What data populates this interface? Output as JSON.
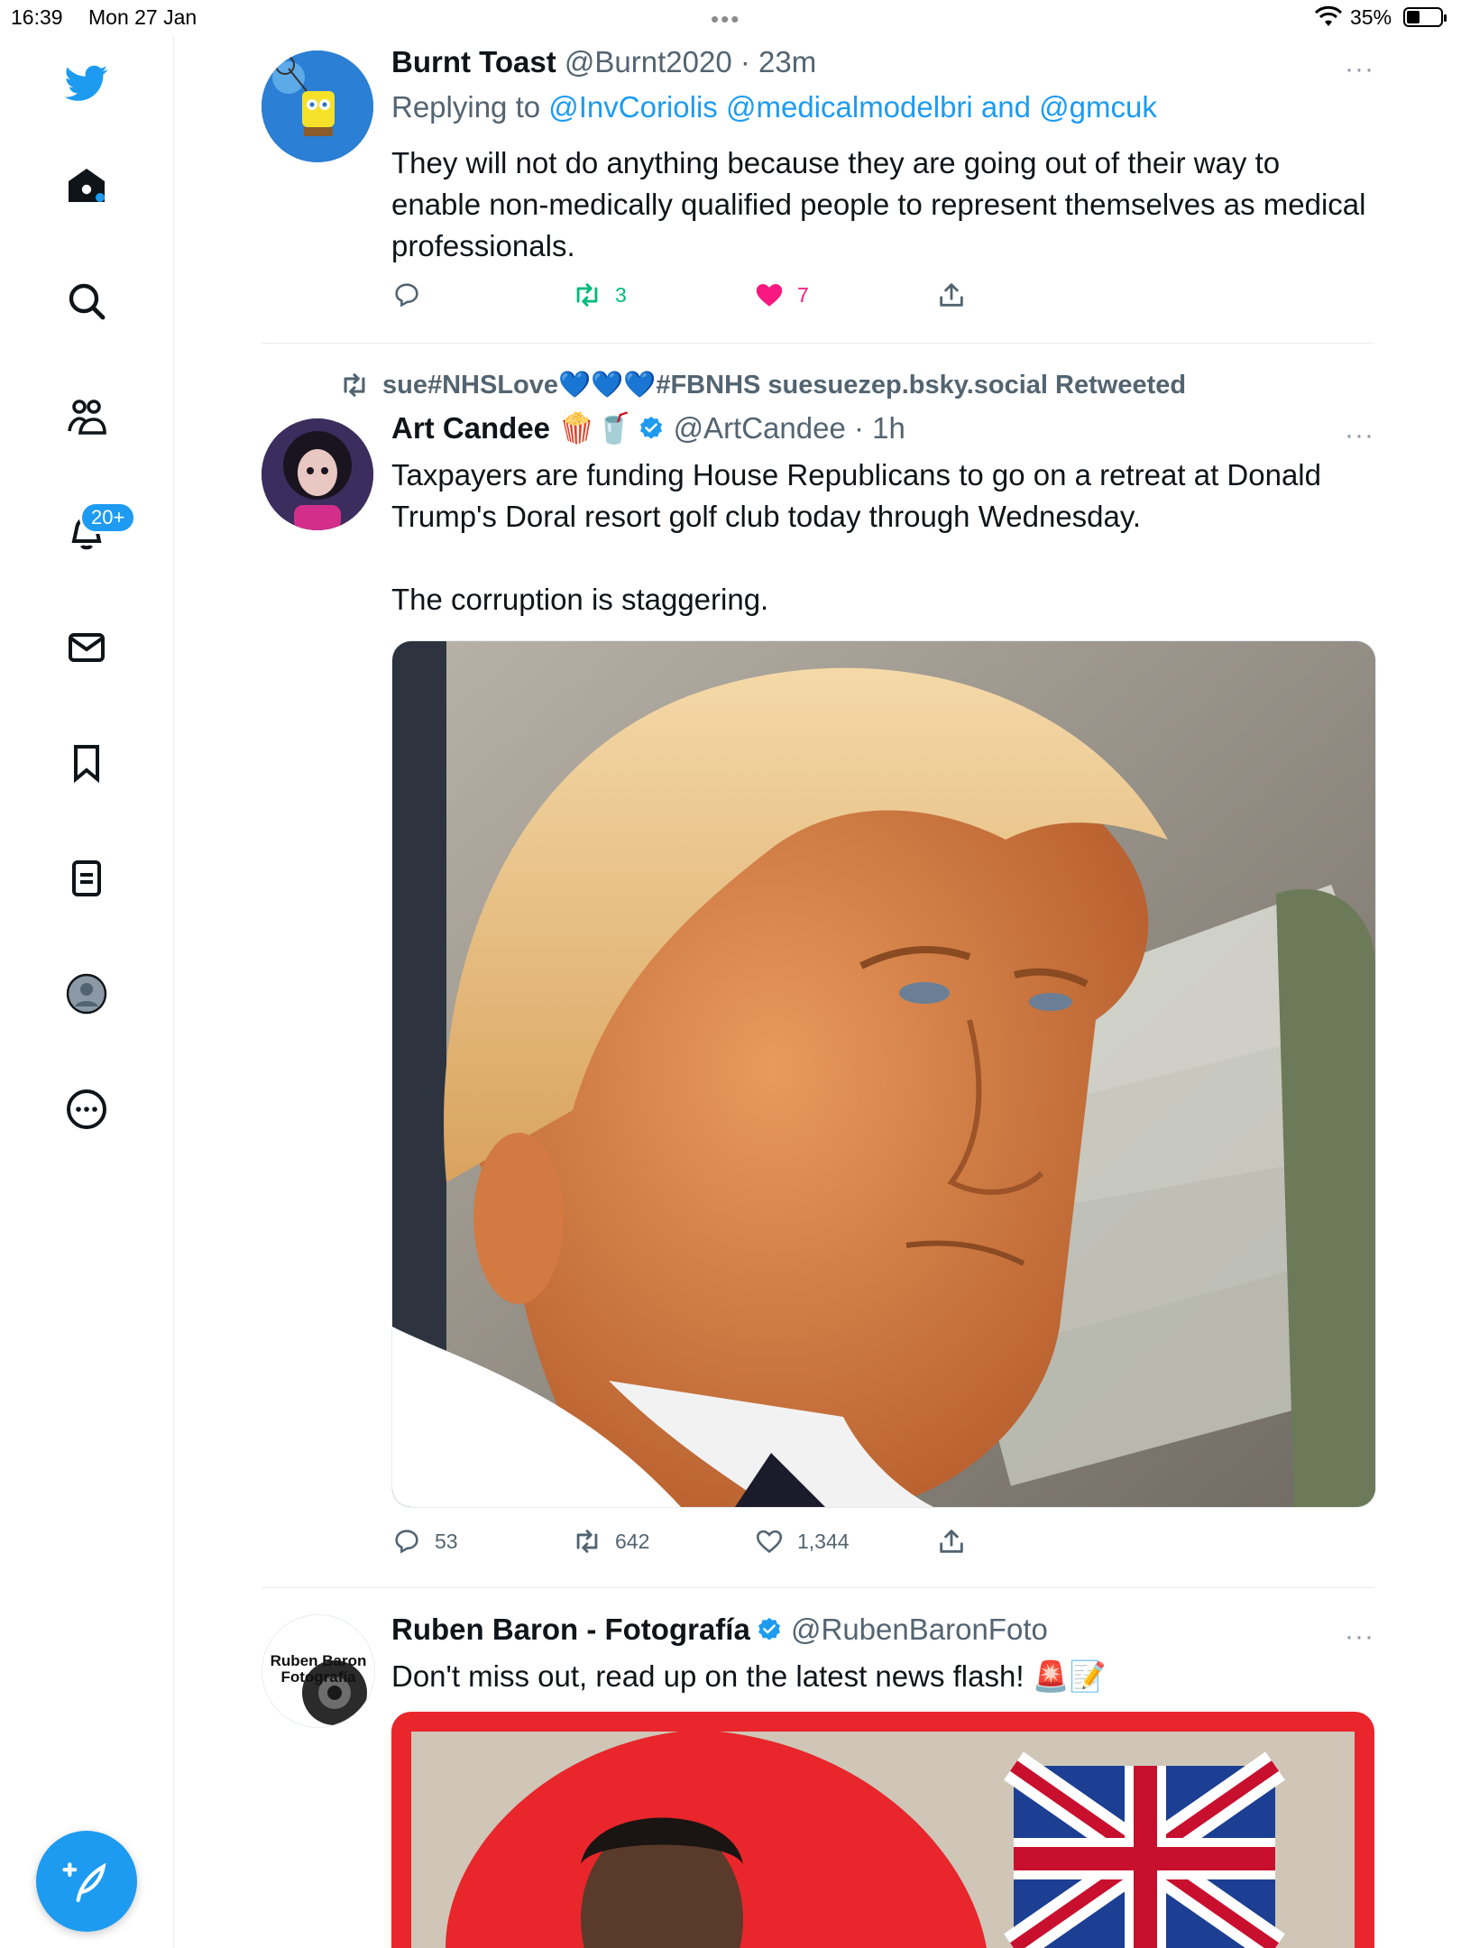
{
  "status_bar": {
    "time": "16:39",
    "date": "Mon 27 Jan",
    "battery": "35%"
  },
  "sidebar": {
    "items": [
      {
        "name": "twitter-logo-icon"
      },
      {
        "name": "home-icon"
      },
      {
        "name": "search-icon"
      },
      {
        "name": "communities-icon"
      },
      {
        "name": "notifications-icon"
      },
      {
        "name": "messages-icon"
      },
      {
        "name": "bookmarks-icon"
      },
      {
        "name": "lists-icon"
      },
      {
        "name": "profile-icon"
      },
      {
        "name": "more-icon"
      }
    ],
    "notifications_badge": "20+",
    "compose_icon": "compose-feather-icon"
  },
  "colors": {
    "accent": "#1d9bf0",
    "retweet": "#00ba7c",
    "like": "#f91880",
    "muted": "#536471"
  },
  "tweets": [
    {
      "name": "Burnt Toast",
      "handle": "@Burnt2020",
      "time": "23m",
      "replying_prefix": "Replying to ",
      "replying_to": "@InvCoriolis @medicalmodelbri and @gmcuk",
      "text": "They will not do anything because they are going out of their way to enable non-medically qualified people to represent themselves as medical professionals.",
      "replies": "",
      "retweets": "3",
      "likes": "7"
    },
    {
      "retweeted_by": "sue#NHSLove💙💙💙#FBNHS suesuezep.bsky.social Retweeted",
      "name": "Art Candee 🍿🥤",
      "handle": "@ArtCandee",
      "time": "1h",
      "text": "Taxpayers are funding House Republicans to go on a retreat at Donald Trump's Doral resort golf club today through Wednesday.\n\nThe corruption is staggering.",
      "replies": "53",
      "retweets": "642",
      "likes": "1,344"
    },
    {
      "name": "Ruben Baron - Fotografía",
      "handle": "@RubenBaronFoto",
      "text": "Don't miss out, read up on the latest news flash! 🚨📝",
      "avatar_text": "Ruben Baron Fotografía"
    }
  ]
}
